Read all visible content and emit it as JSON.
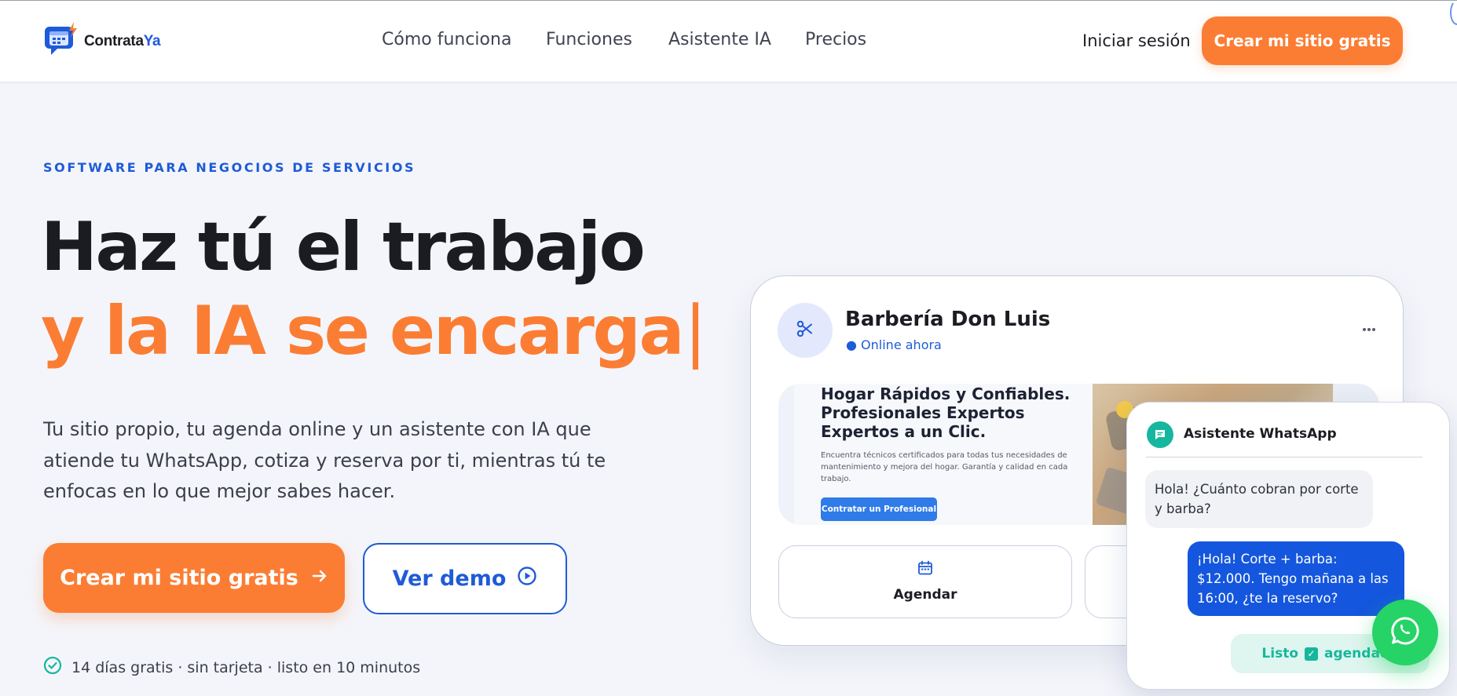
{
  "brand": {
    "name_part1": "Contrata",
    "name_part2": "Ya",
    "icon": "calendar-chat-icon",
    "colors": {
      "primary": "#1e5bd8",
      "accent": "#fb7d33",
      "whatsapp": "#25d366",
      "teal": "#16b79e"
    }
  },
  "nav": {
    "links": [
      "Cómo funciona",
      "Funciones",
      "Asistente IA",
      "Precios"
    ],
    "login_label": "Iniciar sesión",
    "cta_label": "Crear mi sitio gratis"
  },
  "hero": {
    "eyebrow": "SOFTWARE PARA NEGOCIOS DE SERVICIOS",
    "title_line1": "Haz tú el trabajo",
    "title_line2": "y la IA se encarga",
    "caret": "|",
    "lead": "Tu sitio propio, tu agenda online y un asistente con IA que atiende tu WhatsApp, cotiza y reserva por ti, mientras tú te enfocas en lo que mejor sabes hacer.",
    "primary_button": "Crear mi sitio gratis",
    "secondary_button": "Ver demo",
    "trust_text": "14 días gratis · sin tarjeta · listo en 10 minutos"
  },
  "preview_card": {
    "business_name": "Barbería Don Luis",
    "status": "Online ahora",
    "avatar_icon": "scissors-icon",
    "banner": {
      "heading_lines": [
        "Hogar Rápidos y Confiables.",
        "Profesionales Expertos",
        "Expertos a un Clic."
      ],
      "body": "Encuentra técnicos certificados para todas tus necesidades de mantenimiento y mejora del hogar. Garantía y calidad en cada trabajo.",
      "button": "Contratar un Profesional"
    },
    "actions": [
      {
        "label": "Agendar",
        "icon": "calendar-icon"
      }
    ]
  },
  "chat": {
    "title": "Asistente WhatsApp",
    "messages": [
      {
        "from": "customer",
        "text": "Hola! ¿Cuánto cobran por corte y barba?"
      },
      {
        "from": "assistant",
        "text": "¡Hola! Corte + barba: $12.000. Tengo mañana a las 16:00, ¿te la reservo?"
      }
    ],
    "status_left": "Listo",
    "status_right": "agendada"
  }
}
